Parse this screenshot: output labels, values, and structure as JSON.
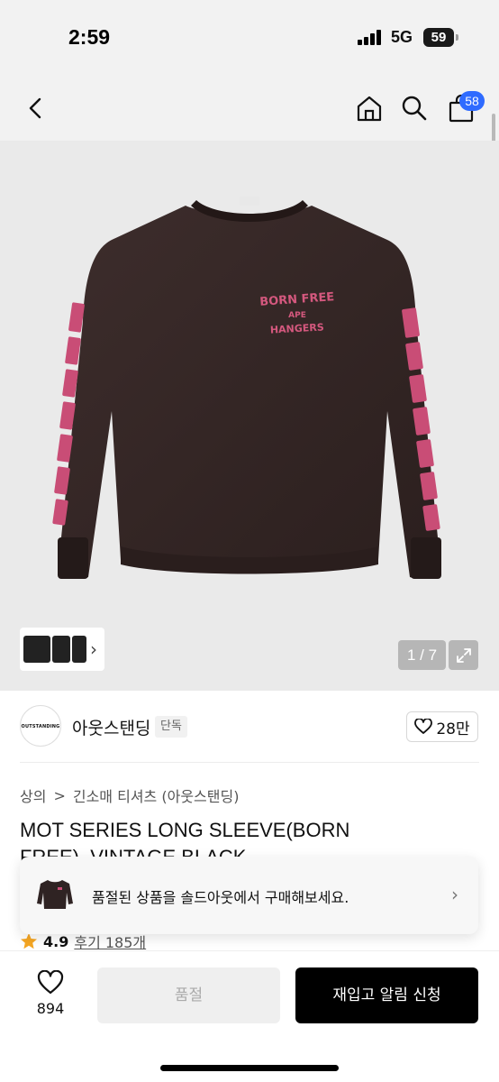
{
  "status_bar": {
    "time": "2:59",
    "network": "5G",
    "battery": "59"
  },
  "nav": {
    "back_icon": "chevron-left-icon",
    "home_icon": "home-icon",
    "search_icon": "search-icon",
    "cart_icon": "bag-icon",
    "cart_badge": "58"
  },
  "gallery": {
    "print_text": [
      "BORN FREE",
      "APE",
      "HANGERS"
    ],
    "counter": "1 / 7",
    "thumb_chevron": "›"
  },
  "brand": {
    "logo_text": "OUTSTANDING",
    "name": "아웃스탠딩",
    "tag": "단독",
    "likes": "28만"
  },
  "breadcrumb": {
    "root": "상의",
    "separator": ">",
    "category": "긴소매 티셔츠 (아웃스탠딩)"
  },
  "product": {
    "title": "MOT SERIES LONG SLEEVE(BORN FREE)_VINTAGE BLACK"
  },
  "banner": {
    "text": "품절된 상품을 솔드아웃에서 구매해보세요.",
    "chevron": "›"
  },
  "rating": {
    "score": "4.9",
    "reviews": "후기 185개"
  },
  "bottom": {
    "wish_count": "894",
    "soldout_label": "품절",
    "restock_label": "재입고 알림 신청"
  },
  "colors": {
    "accent_badge": "#2f6bff",
    "shirt": "#352726",
    "print_pink": "#d4587e",
    "star": "#f5a623"
  }
}
